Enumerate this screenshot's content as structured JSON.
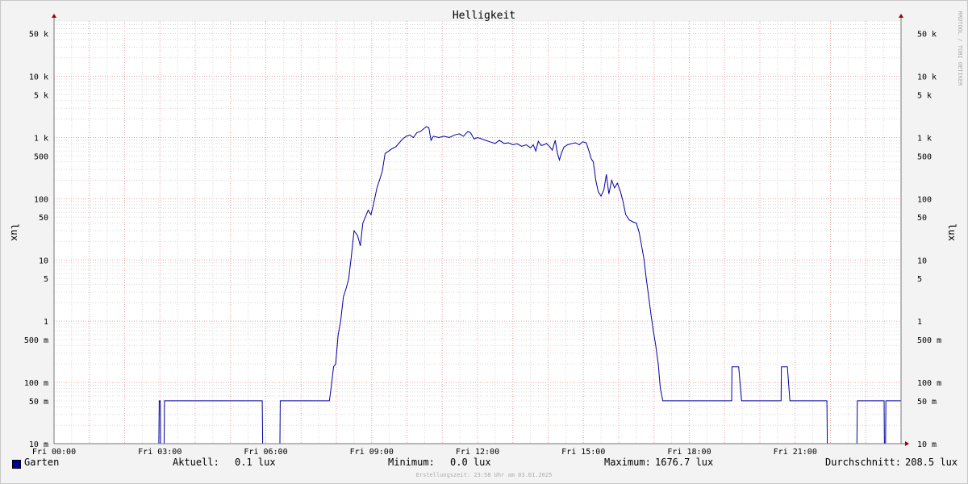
{
  "chart_data": {
    "type": "line",
    "title": "Helligkeit",
    "ylabel": "lux",
    "y_scale": "log",
    "ylim": [
      0.01,
      80000
    ],
    "xlim": [
      0,
      24
    ],
    "x_unit": "hours since Fri 00:00",
    "grid": true,
    "x_tick_labels": [
      {
        "x": 0,
        "label": "Fri 00:00"
      },
      {
        "x": 3,
        "label": "Fri 03:00"
      },
      {
        "x": 6,
        "label": "Fri 06:00"
      },
      {
        "x": 9,
        "label": "Fri 09:00"
      },
      {
        "x": 12,
        "label": "Fri 12:00"
      },
      {
        "x": 15,
        "label": "Fri 15:00"
      },
      {
        "x": 18,
        "label": "Fri 18:00"
      },
      {
        "x": 21,
        "label": "Fri 21:00"
      }
    ],
    "y_tick_labels": [
      {
        "y": 50000,
        "label": "50 k"
      },
      {
        "y": 10000,
        "label": "10 k"
      },
      {
        "y": 5000,
        "label": "5 k"
      },
      {
        "y": 1000,
        "label": "1 k"
      },
      {
        "y": 500,
        "label": "500"
      },
      {
        "y": 100,
        "label": "100"
      },
      {
        "y": 50,
        "label": "50"
      },
      {
        "y": 10,
        "label": "10"
      },
      {
        "y": 5,
        "label": "5"
      },
      {
        "y": 1,
        "label": "1"
      },
      {
        "y": 0.5,
        "label": "500 m"
      },
      {
        "y": 0.1,
        "label": "100 m"
      },
      {
        "y": 0.05,
        "label": "50 m"
      },
      {
        "y": 0.01,
        "label": "10 m"
      }
    ],
    "series": [
      {
        "name": "Garten",
        "color": "#0000a0",
        "points": [
          [
            0.0,
            0.01
          ],
          [
            2.97,
            0.01
          ],
          [
            2.98,
            0.05
          ],
          [
            3.01,
            0.05
          ],
          [
            3.02,
            0.01
          ],
          [
            3.12,
            0.01
          ],
          [
            3.13,
            0.05
          ],
          [
            5.9,
            0.05
          ],
          [
            5.91,
            0.01
          ],
          [
            6.4,
            0.01
          ],
          [
            6.41,
            0.05
          ],
          [
            7.8,
            0.05
          ],
          [
            7.85,
            0.08
          ],
          [
            7.92,
            0.18
          ],
          [
            7.98,
            0.2
          ],
          [
            8.05,
            0.6
          ],
          [
            8.12,
            1.0
          ],
          [
            8.2,
            2.5
          ],
          [
            8.28,
            3.5
          ],
          [
            8.35,
            5.0
          ],
          [
            8.42,
            11
          ],
          [
            8.5,
            30
          ],
          [
            8.6,
            25
          ],
          [
            8.68,
            17
          ],
          [
            8.75,
            40
          ],
          [
            8.82,
            50
          ],
          [
            8.9,
            65
          ],
          [
            8.98,
            55
          ],
          [
            9.05,
            80
          ],
          [
            9.15,
            150
          ],
          [
            9.22,
            200
          ],
          [
            9.3,
            280
          ],
          [
            9.38,
            550
          ],
          [
            9.48,
            600
          ],
          [
            9.58,
            660
          ],
          [
            9.68,
            700
          ],
          [
            9.78,
            820
          ],
          [
            9.88,
            950
          ],
          [
            9.98,
            1050
          ],
          [
            10.08,
            1100
          ],
          [
            10.18,
            1000
          ],
          [
            10.28,
            1200
          ],
          [
            10.38,
            1250
          ],
          [
            10.48,
            1400
          ],
          [
            10.55,
            1500
          ],
          [
            10.62,
            1450
          ],
          [
            10.68,
            900
          ],
          [
            10.75,
            1050
          ],
          [
            10.9,
            1000
          ],
          [
            11.05,
            1050
          ],
          [
            11.2,
            1000
          ],
          [
            11.35,
            1100
          ],
          [
            11.48,
            1150
          ],
          [
            11.6,
            1050
          ],
          [
            11.72,
            1250
          ],
          [
            11.8,
            1200
          ],
          [
            11.9,
            950
          ],
          [
            12.0,
            1000
          ],
          [
            12.12,
            950
          ],
          [
            12.22,
            900
          ],
          [
            12.35,
            850
          ],
          [
            12.5,
            800
          ],
          [
            12.62,
            900
          ],
          [
            12.75,
            800
          ],
          [
            12.88,
            820
          ],
          [
            13.0,
            760
          ],
          [
            13.12,
            790
          ],
          [
            13.25,
            720
          ],
          [
            13.38,
            760
          ],
          [
            13.5,
            680
          ],
          [
            13.58,
            760
          ],
          [
            13.65,
            600
          ],
          [
            13.72,
            870
          ],
          [
            13.8,
            740
          ],
          [
            13.88,
            760
          ],
          [
            13.95,
            800
          ],
          [
            14.05,
            700
          ],
          [
            14.12,
            620
          ],
          [
            14.2,
            900
          ],
          [
            14.26,
            560
          ],
          [
            14.32,
            430
          ],
          [
            14.38,
            560
          ],
          [
            14.45,
            700
          ],
          [
            14.55,
            760
          ],
          [
            14.68,
            800
          ],
          [
            14.78,
            820
          ],
          [
            14.88,
            760
          ],
          [
            14.98,
            850
          ],
          [
            15.08,
            820
          ],
          [
            15.15,
            620
          ],
          [
            15.22,
            450
          ],
          [
            15.28,
            400
          ],
          [
            15.35,
            200
          ],
          [
            15.42,
            130
          ],
          [
            15.5,
            110
          ],
          [
            15.58,
            140
          ],
          [
            15.65,
            250
          ],
          [
            15.72,
            120
          ],
          [
            15.8,
            200
          ],
          [
            15.88,
            150
          ],
          [
            15.96,
            180
          ],
          [
            16.05,
            130
          ],
          [
            16.12,
            90
          ],
          [
            16.2,
            55
          ],
          [
            16.3,
            45
          ],
          [
            16.4,
            42
          ],
          [
            16.5,
            40
          ],
          [
            16.58,
            28
          ],
          [
            16.65,
            17
          ],
          [
            16.72,
            10
          ],
          [
            16.78,
            5
          ],
          [
            16.85,
            2.5
          ],
          [
            16.92,
            1.2
          ],
          [
            16.98,
            0.7
          ],
          [
            17.05,
            0.4
          ],
          [
            17.12,
            0.2
          ],
          [
            17.18,
            0.08
          ],
          [
            17.25,
            0.05
          ],
          [
            19.2,
            0.05
          ],
          [
            19.21,
            0.18
          ],
          [
            19.4,
            0.18
          ],
          [
            19.48,
            0.05
          ],
          [
            20.6,
            0.05
          ],
          [
            20.61,
            0.18
          ],
          [
            20.78,
            0.18
          ],
          [
            20.85,
            0.05
          ],
          [
            21.9,
            0.05
          ],
          [
            21.91,
            0.01
          ],
          [
            22.75,
            0.01
          ],
          [
            22.76,
            0.05
          ],
          [
            23.52,
            0.05
          ],
          [
            23.53,
            0.01
          ],
          [
            23.56,
            0.01
          ],
          [
            23.57,
            0.05
          ],
          [
            24.0,
            0.05
          ]
        ]
      }
    ]
  },
  "legend": {
    "series_label": "Garten",
    "current_label": "Aktuell:",
    "current_value": "0.1 lux",
    "minimum_label": "Minimum:",
    "minimum_value": "0.0 lux",
    "maximum_label": "Maximum:",
    "maximum_value": "1676.7 lux",
    "average_label": "Durchschnitt:",
    "average_value": "208.5 lux"
  },
  "footer": "Erstellungszeit: 23:58 Uhr am 03.01.2025",
  "watermark": "RRDTOOL / TOBI OETIKER",
  "colors": {
    "line": "#0000a0",
    "grid_major": "#e8a0a0",
    "grid_minor": "#d8d8d8",
    "background": "#ffffff",
    "canvas": "#f3f3f3"
  }
}
